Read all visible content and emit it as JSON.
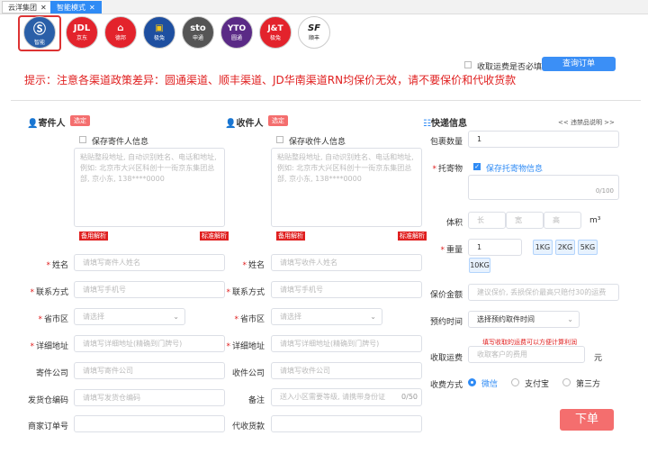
{
  "tabs": [
    {
      "label": "云洋集团",
      "active": false
    },
    {
      "label": "智能模式",
      "active": true
    }
  ],
  "carriers": [
    {
      "name": "smart",
      "line1": "",
      "line2": "智能",
      "color": "#2a5fa8"
    },
    {
      "name": "jd",
      "line1": "JDL",
      "line2": "京东",
      "color": "#e3232c"
    },
    {
      "name": "debang",
      "line1": "",
      "line2": "德邦",
      "color": "#e3232c"
    },
    {
      "name": "jtx",
      "line1": "",
      "line2": "极兔",
      "color": "#1e4fa0"
    },
    {
      "name": "sto",
      "line1": "sto",
      "line2": "申通",
      "color": "#555"
    },
    {
      "name": "yto",
      "line1": "YTO",
      "line2": "圆通",
      "color": "#5a2a86"
    },
    {
      "name": "jt",
      "line1": "J&T",
      "line2": "极兔",
      "color": "#e3232c"
    },
    {
      "name": "sf",
      "line1": "SF",
      "line2": "顺丰",
      "color": "#fff"
    }
  ],
  "header": {
    "compulsory_label": "收取运费是否必填",
    "query_button": "查询订单"
  },
  "tip": "提示：注意各渠道政策差异：圆通渠道、顺丰渠道、JD华南渠道RN均保价无效，请不要保价和代收货款",
  "sender": {
    "title": "寄件人",
    "select_tag": "选定",
    "save_label": "保存寄件人信息",
    "address_placeholder": "粘贴整段地址, 自动识别姓名、电话和地址, 例如: 北京市大兴区科创十一街京东集团总部, 京小东, 138****0000",
    "parse_left": "备用解析",
    "parse_right": "标准解析",
    "fields": {
      "name_label": "姓名",
      "name_ph": "请填写寄件人姓名",
      "phone_label": "联系方式",
      "phone_ph": "请填写手机号",
      "region_label": "省市区",
      "region_ph": "请选择",
      "addr_label": "详细地址",
      "addr_ph": "请填写详细地址(精确到门牌号)",
      "company_label": "寄件公司",
      "company_ph": "请填写寄件公司",
      "warehouse_label": "发货仓编码",
      "warehouse_ph": "请填写发货仓编码",
      "order_label": "商家订单号"
    }
  },
  "receiver": {
    "title": "收件人",
    "select_tag": "选定",
    "save_label": "保存收件人信息",
    "address_placeholder": "粘贴整段地址, 自动识别姓名、电话和地址, 例如: 北京市大兴区科创十一街京东集团总部, 京小东, 138****0000",
    "parse_left": "备用解析",
    "parse_right": "标准解析",
    "fields": {
      "name_label": "姓名",
      "name_ph": "请填写收件人姓名",
      "phone_label": "联系方式",
      "phone_ph": "请填写手机号",
      "region_label": "省市区",
      "region_ph": "请选择",
      "addr_label": "详细地址",
      "addr_ph": "请填写详细地址(精确到门牌号)",
      "company_label": "收件公司",
      "company_ph": "请填写收件公司",
      "remark_label": "备注",
      "remark_ph": "送入小区需要等级, 请携带身份证",
      "remark_count": "0/50",
      "cod_label": "代收货款"
    }
  },
  "express": {
    "title": "快递信息",
    "prohibited_link": "<< 违禁品说明 >>",
    "package_label": "包裹数量",
    "package_value": "1",
    "item_label": "托寄物",
    "item_save": "保存托寄物信息",
    "item_count": "0/100",
    "volume_label": "体积",
    "len_ph": "长",
    "wid_ph": "宽",
    "hei_ph": "高",
    "volume_unit": "m³",
    "weight_label": "重量",
    "weight_value": "1",
    "weights": [
      "1KG",
      "2KG",
      "5KG",
      "10KG"
    ],
    "insure_label": "保价金额",
    "insure_ph": "建议保价, 丢损保价最高只赔付30的运费",
    "time_label": "预约时间",
    "time_ph": "选择预约取件时间",
    "fee_hint": "填写收取的运费可以方便计算利润",
    "fee_label": "收取运费",
    "fee_ph": "收取客户的费用",
    "fee_unit": "元",
    "method_label": "收费方式",
    "methods": [
      "微信",
      "支付宝",
      "第三方"
    ],
    "submit": "下单"
  }
}
